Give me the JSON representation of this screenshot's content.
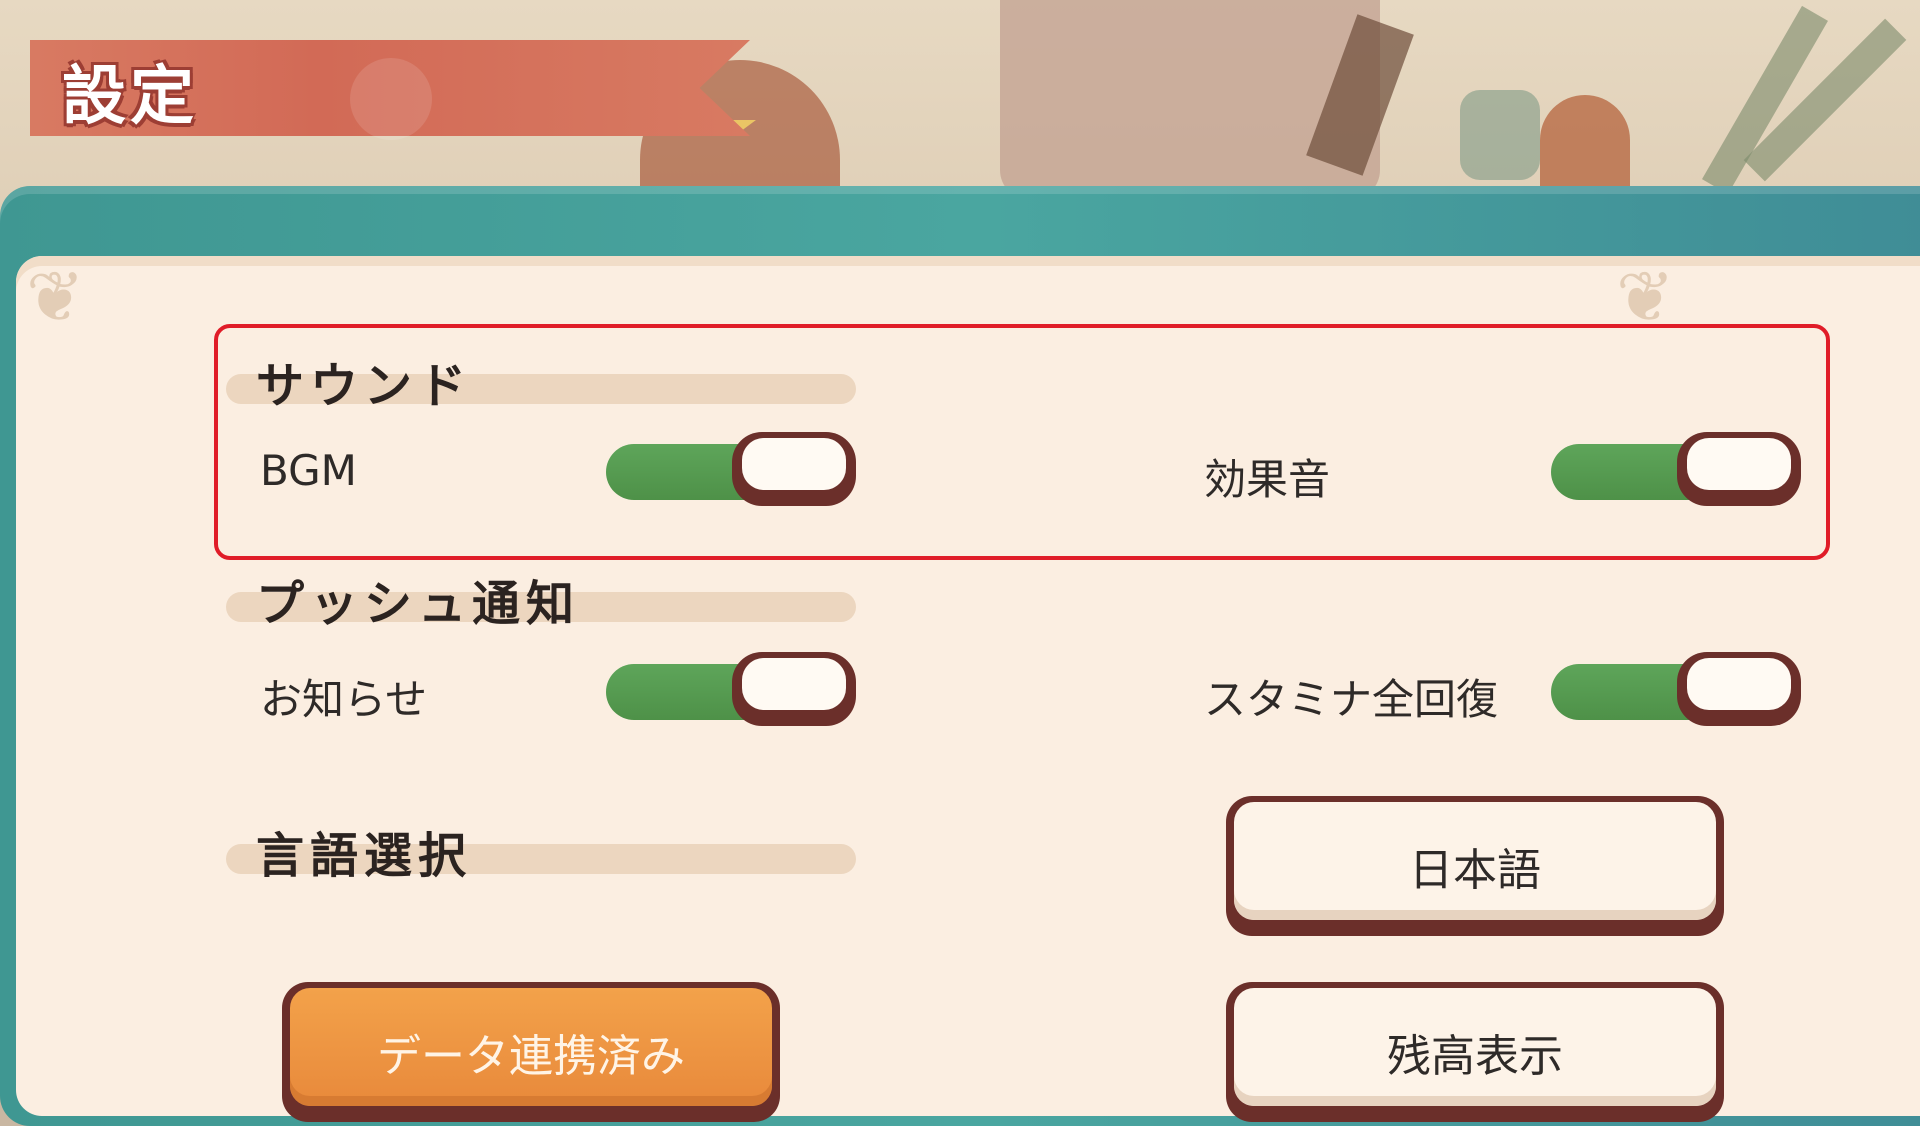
{
  "header": {
    "title": "設定"
  },
  "sections": {
    "sound": {
      "heading": "サウンド",
      "bgm": {
        "label": "BGM",
        "on": true
      },
      "sfx": {
        "label": "効果音",
        "on": true
      }
    },
    "push": {
      "heading": "プッシュ通知",
      "news": {
        "label": "お知らせ",
        "on": true
      },
      "stamina": {
        "label": "スタミナ全回復",
        "on": true
      }
    },
    "language": {
      "heading": "言語選択",
      "current": "日本語"
    }
  },
  "buttons": {
    "data_link": "データ連携済み",
    "balance": "残高表示"
  },
  "colors": {
    "toggle_on": "#5ea55a",
    "accent_orange": "#f3a24a",
    "ribbon": "#d87a62",
    "panel_border": "#4aa6a0",
    "highlight": "#e01c28"
  }
}
